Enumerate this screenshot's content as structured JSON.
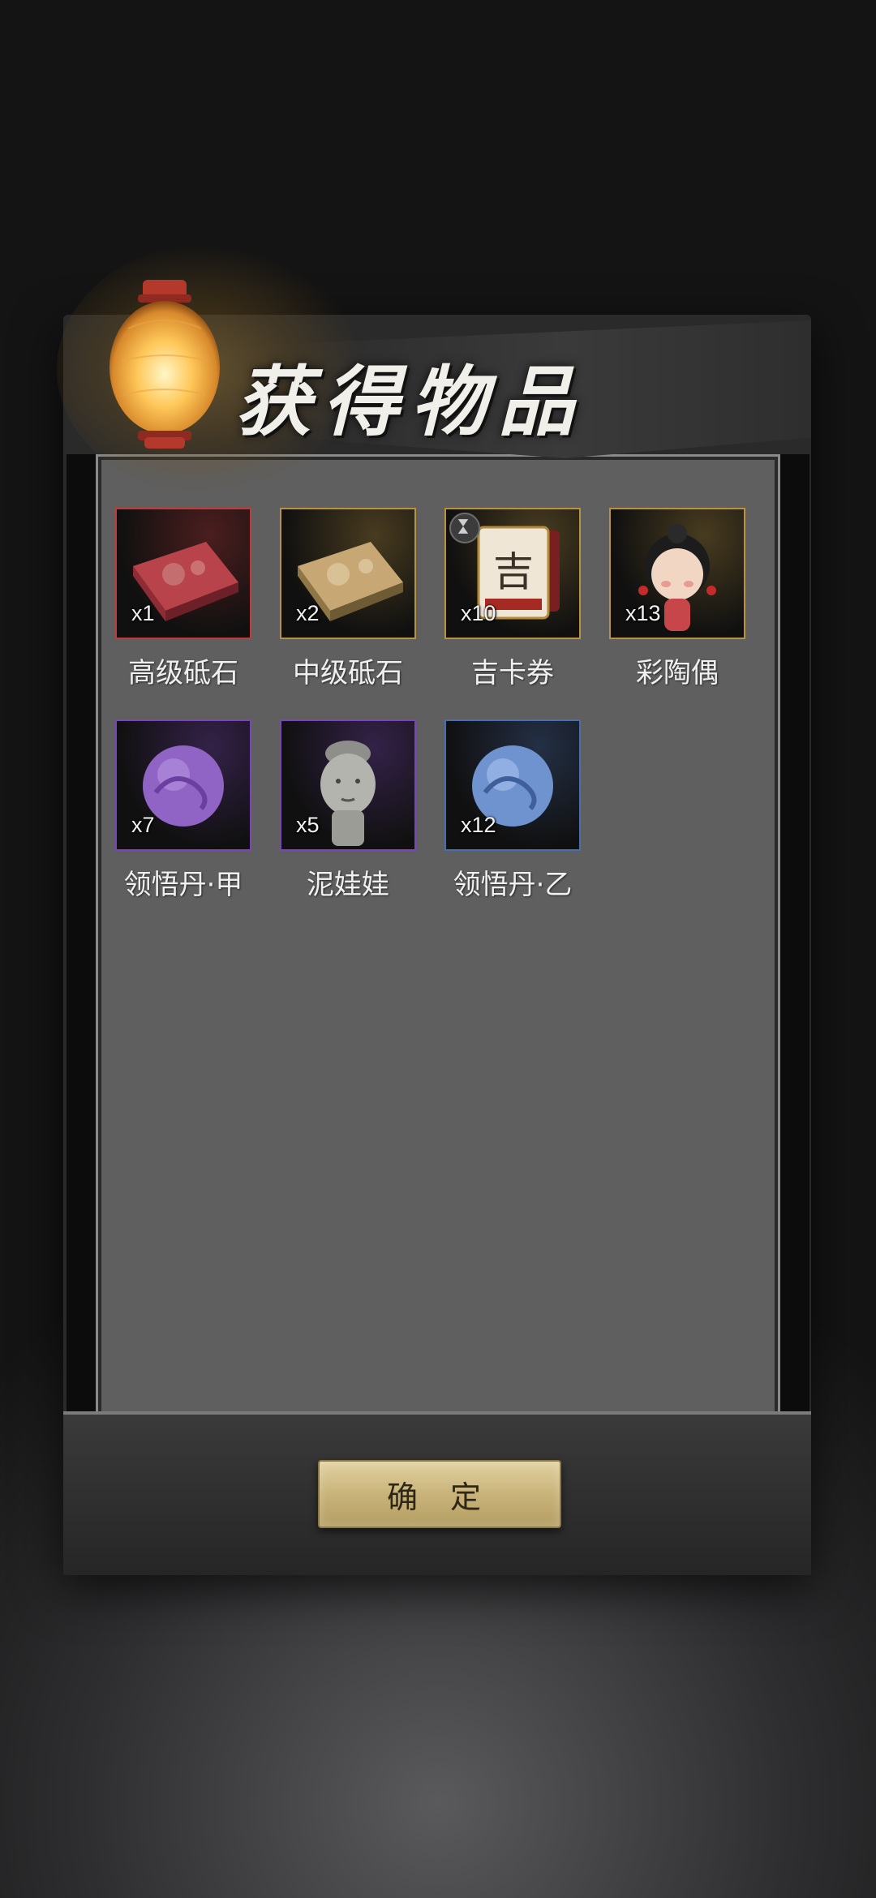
{
  "dialog": {
    "title": "获得物品",
    "confirm_label": "确 定"
  },
  "items": [
    {
      "name": "高级砥石",
      "count": "x1",
      "rarity": "red",
      "icon": "whetstone-red-icon"
    },
    {
      "name": "中级砥石",
      "count": "x2",
      "rarity": "gold",
      "icon": "whetstone-gold-icon"
    },
    {
      "name": "吉卡券",
      "count": "x10",
      "rarity": "gold",
      "icon": "ticket-icon",
      "ticket_char": "吉",
      "timed": true
    },
    {
      "name": "彩陶偶",
      "count": "x13",
      "rarity": "gold",
      "icon": "doll-icon"
    },
    {
      "name": "领悟丹·甲",
      "count": "x7",
      "rarity": "purple",
      "icon": "purple-pill-icon"
    },
    {
      "name": "泥娃娃",
      "count": "x5",
      "rarity": "purple",
      "icon": "clay-figure-icon"
    },
    {
      "name": "领悟丹·乙",
      "count": "x12",
      "rarity": "blue",
      "icon": "blue-pill-icon"
    }
  ],
  "colors": {
    "red": "#c23a3a",
    "gold": "#b8923e",
    "purple": "#7a45b8",
    "blue": "#4a6fb0"
  }
}
